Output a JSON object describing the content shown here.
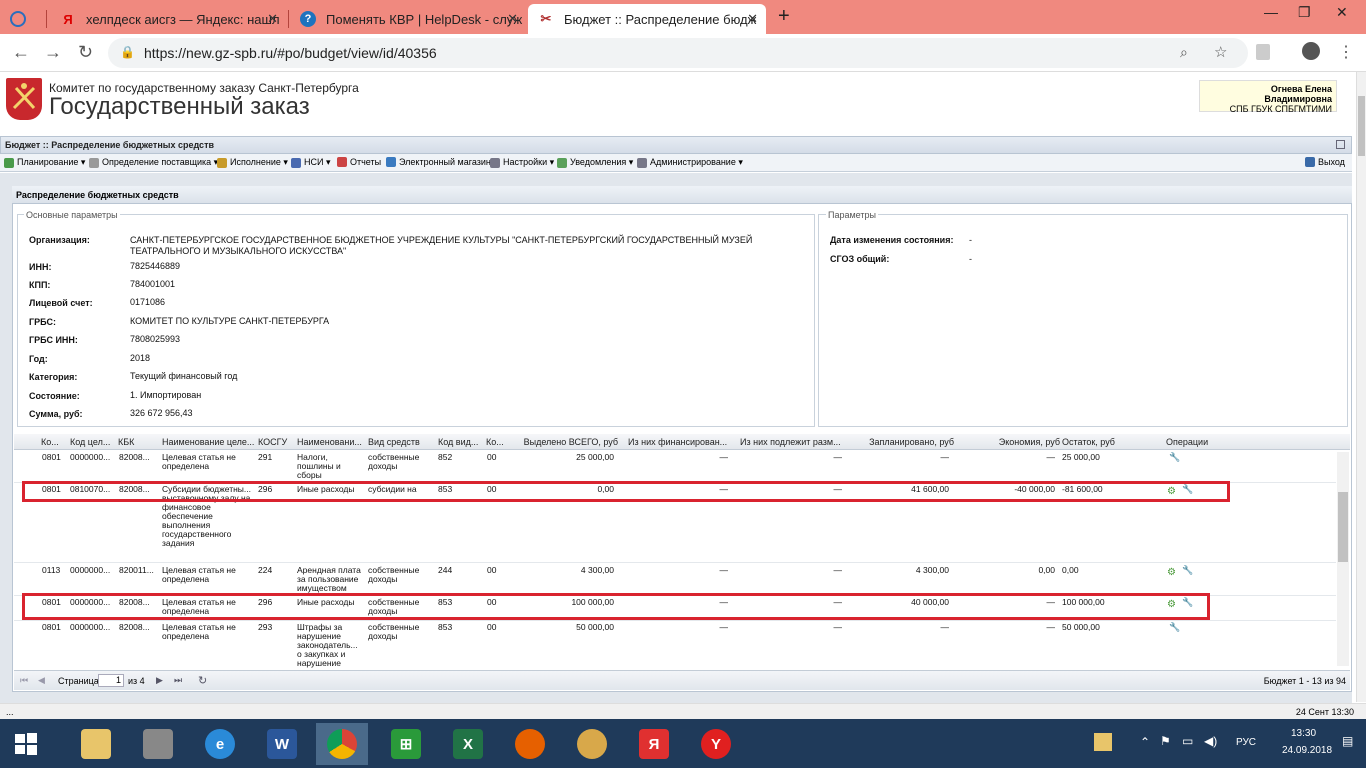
{
  "browser": {
    "tabs": [
      {
        "title": "хелпдеск аисгз — Яндекс: нашл",
        "icon": "yandex-icon"
      },
      {
        "title": "Поменять КВР | HelpDesk - служ",
        "icon": "help-icon"
      },
      {
        "title": "Бюджет :: Распределение бюдж",
        "icon": "tools-icon",
        "active": true
      }
    ],
    "url": "https://new.gz-spb.ru/#po/budget/view/id/40356"
  },
  "header": {
    "org": "Комитет по государственному заказу Санкт-Петербурга",
    "site": "Государственный заказ",
    "user_name": "Огнева Елена Владимировна",
    "user_org": "СПБ ГБУК СПБГМТИМИ"
  },
  "app": {
    "breadcrumb": "Бюджет :: Распределение бюджетных средств",
    "menu": [
      "Планирование ▾",
      "Определение поставщика ▾",
      "Исполнение ▾",
      "НСИ ▾",
      "Отчеты",
      "Электронный магазин",
      "Настройки ▾",
      "Уведомления ▾",
      "Администрирование ▾"
    ],
    "exit": "Выход",
    "panel_title": "Распределение бюджетных средств"
  },
  "main_params": {
    "legend": "Основные параметры",
    "fields": [
      {
        "label": "Организация:",
        "value": "САНКТ-ПЕТЕРБУРГСКОЕ ГОСУДАРСТВЕННОЕ БЮДЖЕТНОЕ УЧРЕЖДЕНИЕ КУЛЬТУРЫ \"САНКТ-ПЕТЕРБУРГСКИЙ ГОСУДАРСТВЕННЫЙ МУЗЕЙ ТЕАТРАЛЬНОГО И МУЗЫКАЛЬНОГО ИСКУССТВА\""
      },
      {
        "label": "ИНН:",
        "value": "7825446889"
      },
      {
        "label": "КПП:",
        "value": "784001001"
      },
      {
        "label": "Лицевой счет:",
        "value": "0171086"
      },
      {
        "label": "ГРБС:",
        "value": "КОМИТЕТ ПО КУЛЬТУРЕ САНКТ-ПЕТЕРБУРГА"
      },
      {
        "label": "ГРБС ИНН:",
        "value": "7808025993"
      },
      {
        "label": "Год:",
        "value": "2018"
      },
      {
        "label": "Категория:",
        "value": "Текущий финансовый год"
      },
      {
        "label": "Состояние:",
        "value": "1. Импортирован"
      },
      {
        "label": "Сумма, руб:",
        "value": "326 672 956,43"
      }
    ]
  },
  "params": {
    "legend": "Параметры",
    "fields": [
      {
        "label": "Дата изменения состояния:",
        "value": "-"
      },
      {
        "label": "СГОЗ общий:",
        "value": "-"
      }
    ]
  },
  "grid": {
    "columns": [
      "Ко...",
      "Код цел...",
      "КБК",
      "Наименование целе...",
      "КОСГУ",
      "Наименовани...",
      "Вид средств",
      "Код вид...",
      "Ко...",
      "Выделено ВСЕГО, руб",
      "Из них финансирован...",
      "Из них подлежит разм...",
      "Запланировано, руб",
      "Экономия, руб",
      "Остаток, руб",
      "Операции"
    ],
    "rows": [
      [
        "0801",
        "0000000...",
        "82008...",
        "Целевая статья не определена",
        "291",
        "Налоги, пошлины и сборы",
        "собственные доходы",
        "852",
        "00",
        "25 000,00",
        "—",
        "—",
        "—",
        "—",
        "25 000,00"
      ],
      [
        "0801",
        "0810070...",
        "82008...",
        "Субсидии бюджетны... выставочному залу на финансовое обеспечение выполнения государственного задания",
        "296",
        "Иные расходы",
        "субсидии на",
        "853",
        "00",
        "0,00",
        "—",
        "—",
        "41 600,00",
        "-40 000,00",
        "-81 600,00"
      ],
      [
        "0113",
        "0000000...",
        "820011...",
        "Целевая статья не определена",
        "224",
        "Арендная плата за пользование имуществом",
        "собственные доходы",
        "244",
        "00",
        "4 300,00",
        "—",
        "—",
        "4 300,00",
        "0,00",
        "0,00"
      ],
      [
        "0801",
        "0000000...",
        "82008...",
        "Целевая статья не определена",
        "296",
        "Иные расходы",
        "собственные доходы",
        "853",
        "00",
        "100 000,00",
        "—",
        "—",
        "40 000,00",
        "—",
        "100 000,00"
      ],
      [
        "0801",
        "0000000...",
        "82008...",
        "Целевая статья не определена",
        "293",
        "Штрафы за нарушение законодатель... о закупках и нарушение",
        "собственные доходы",
        "853",
        "00",
        "50 000,00",
        "—",
        "—",
        "—",
        "—",
        "50 000,00"
      ]
    ]
  },
  "pager": {
    "label": "Страница",
    "page": "1",
    "of": "из 4",
    "summary": "Бюджет 1 - 13 из 94"
  },
  "status": {
    "left": "...",
    "right": "24 Сент 13:30"
  },
  "taskbar": {
    "lang": "РУС",
    "time": "13:30",
    "date": "24.09.2018"
  }
}
